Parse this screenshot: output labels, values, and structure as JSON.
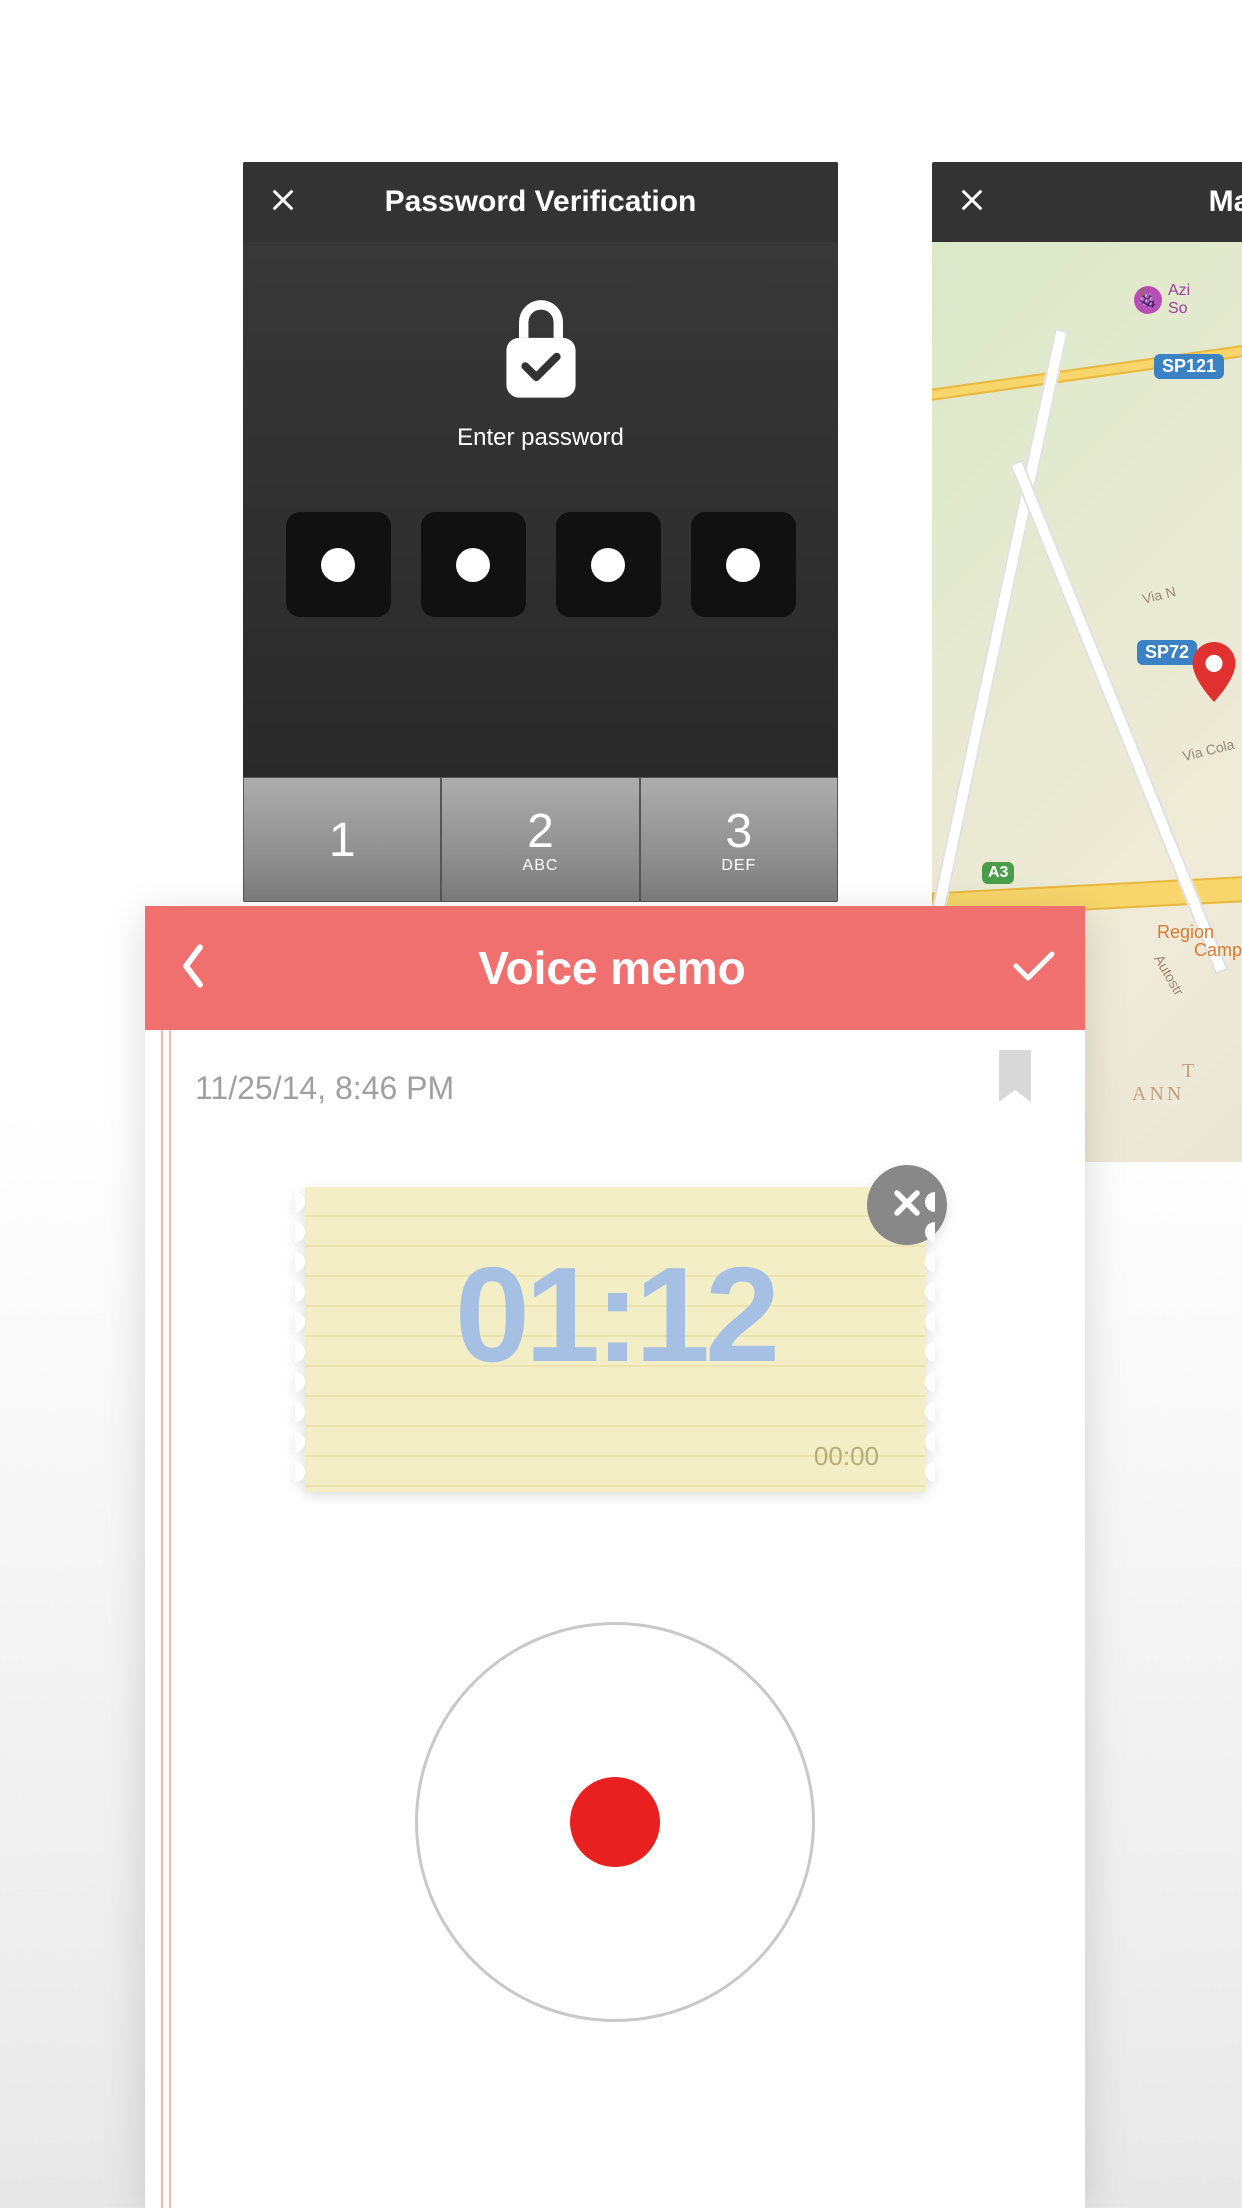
{
  "password_panel": {
    "title": "Password Verification",
    "prompt": "Enter password",
    "keypad": [
      {
        "digit": "1",
        "letters": ""
      },
      {
        "digit": "2",
        "letters": "ABC"
      },
      {
        "digit": "3",
        "letters": "DEF"
      }
    ]
  },
  "map_panel": {
    "title_partial": "Ma",
    "road_labels": {
      "sp121": "SP121",
      "sp72": "SP72",
      "a3": "A3"
    },
    "poi": {
      "grape_partial_1": "Azi",
      "grape_partial_2": "So",
      "region_1": "Region",
      "region_2": "Campa"
    },
    "streets": {
      "via_n": "Via N",
      "via_cola": "Via Cola"
    },
    "ann_text": "ANN",
    "autostr": "Autostr",
    "t_partial": "T"
  },
  "voice_memo": {
    "title": "Voice memo",
    "datetime": "11/25/14, 8:46 PM",
    "elapsed_time": "01:12",
    "sub_time": "00:00"
  }
}
